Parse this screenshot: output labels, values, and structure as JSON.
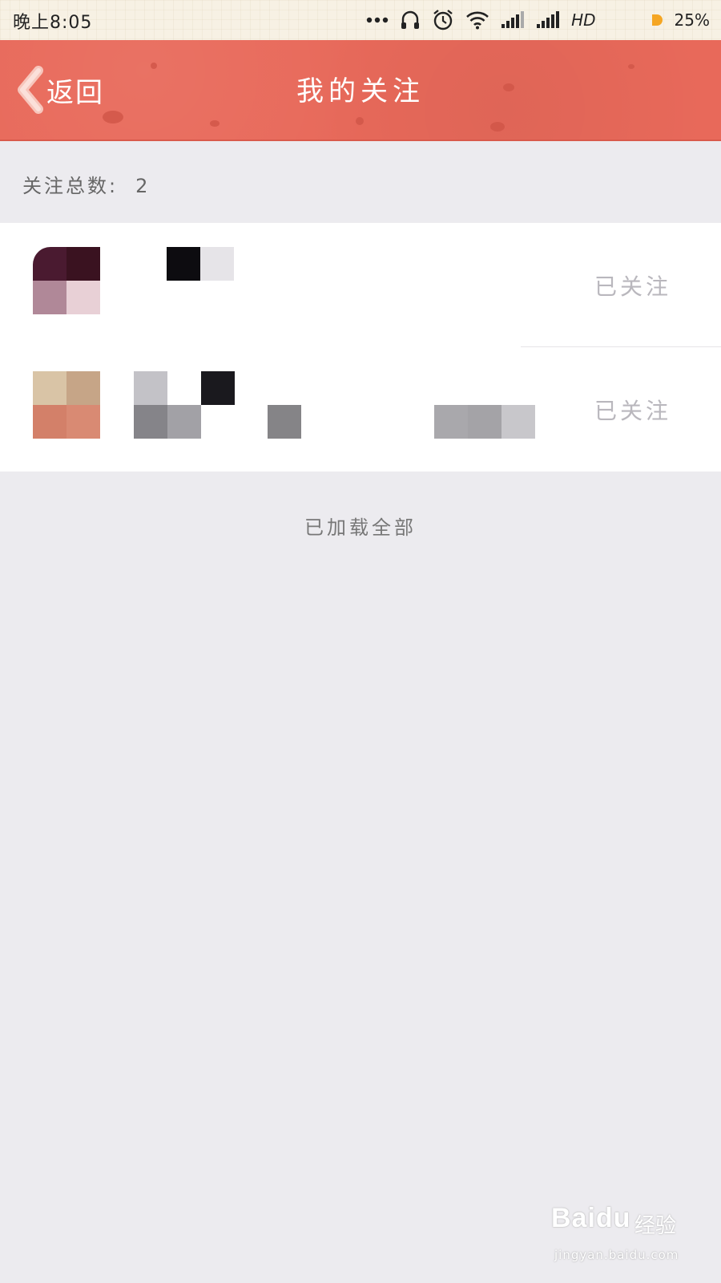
{
  "status_bar": {
    "time": "晚上8:05",
    "network_label": "HD",
    "battery": "25%",
    "icons": [
      "more-dots-icon",
      "headset-icon",
      "alarm-icon",
      "wifi-icon",
      "signal-icon",
      "signal-icon",
      "battery-icon"
    ],
    "battery_color": "#f5a623"
  },
  "header": {
    "back_label": "返回",
    "title": "我的关注",
    "background_color": "#e8695a"
  },
  "summary": {
    "label": "关注总数:",
    "count": "2"
  },
  "follows": [
    {
      "status": "已关注",
      "avatar_colors": [
        "#4a1a30",
        "#3a1220",
        "#b08898",
        "#e8d0d6"
      ],
      "name_mosaic_colors": [
        "#0d0c10",
        "#e6e4e8"
      ]
    },
    {
      "status": "已关注",
      "avatar_colors": [
        "#d9c4a6",
        "#c6a587",
        "#d38069",
        "#d98a73"
      ],
      "name_mosaic_colors": [
        "#c3c2c7",
        "#1a191e",
        "#858489",
        "#a2a1a6",
        "#858487",
        "#a9a8ac",
        "#a4a3a7",
        "#c8c7cb"
      ]
    }
  ],
  "footer": {
    "load_status": "已加载全部"
  },
  "watermark": {
    "logo": "Baidu",
    "brand": "经验",
    "url": "jingyan.baidu.com"
  }
}
